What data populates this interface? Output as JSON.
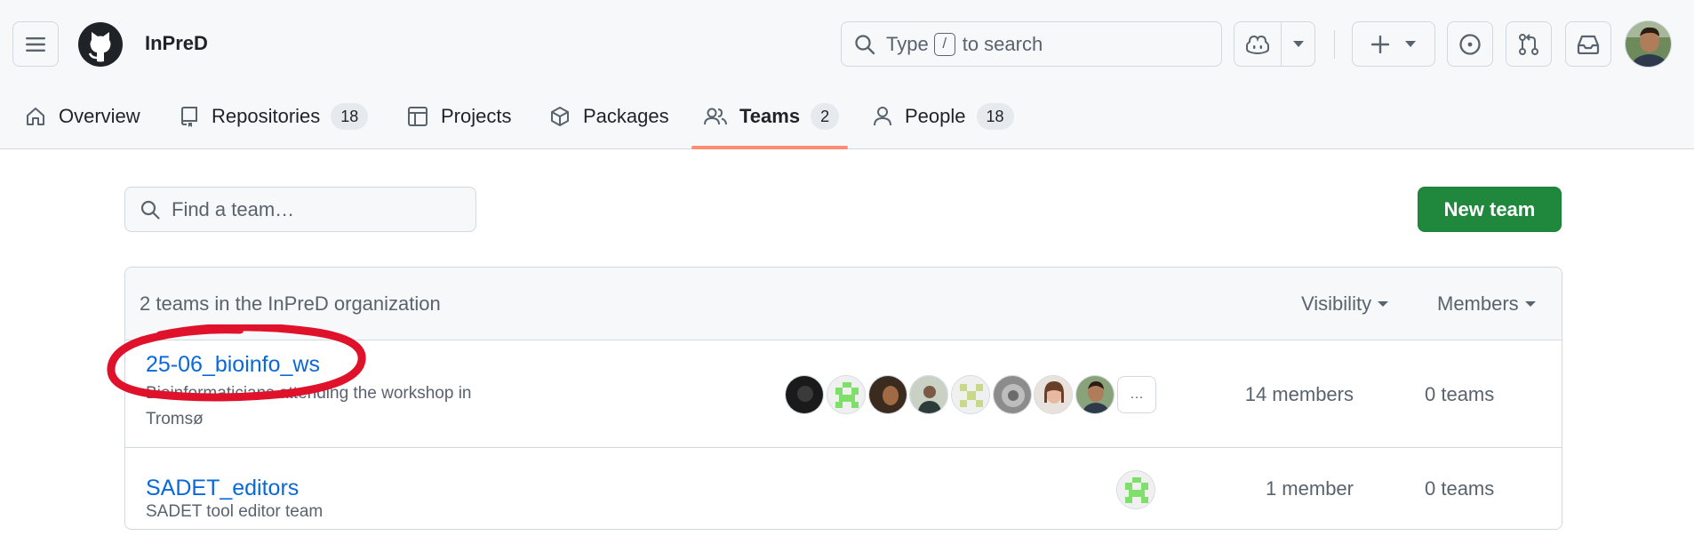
{
  "header": {
    "org_name": "InPreD",
    "search": {
      "prefix": "Type",
      "key": "/",
      "suffix": "to search"
    }
  },
  "nav": {
    "tabs": [
      {
        "label": "Overview",
        "icon": "home-icon"
      },
      {
        "label": "Repositories",
        "icon": "repo-icon",
        "count": "18"
      },
      {
        "label": "Projects",
        "icon": "table-icon"
      },
      {
        "label": "Packages",
        "icon": "package-icon"
      },
      {
        "label": "Teams",
        "icon": "people-icon",
        "count": "2",
        "active": true
      },
      {
        "label": "People",
        "icon": "person-icon",
        "count": "18"
      }
    ]
  },
  "toolbar": {
    "find_placeholder": "Find a team…",
    "new_team_label": "New team"
  },
  "teams_box": {
    "summary": "2 teams in the InPreD organization",
    "visibility_label": "Visibility",
    "members_label": "Members",
    "rows": [
      {
        "name": "25-06_bioinfo_ws",
        "description_line1": "Bioinformaticians attending the workshop in",
        "description_line2": "Tromsø",
        "members": "14 members",
        "teams": "0 teams",
        "more_label": "…"
      },
      {
        "name": "SADET_editors",
        "description_line1": "SADET tool editor team",
        "members": "1 member",
        "teams": "0 teams"
      }
    ]
  },
  "colors": {
    "link": "#0969da",
    "primary_button": "#1f883d",
    "active_tab_underline": "#fd8c73",
    "annotation": "#e0112b",
    "identicon_green": "#7ee06a"
  }
}
